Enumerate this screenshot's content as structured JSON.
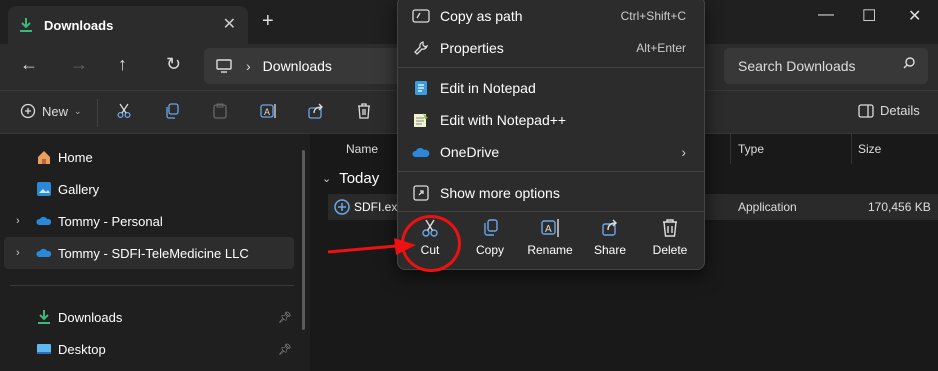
{
  "tab": {
    "title": "Downloads",
    "close": "✕",
    "new_tab": "+"
  },
  "window": {
    "minimize": "—",
    "maximize": "☐",
    "close": "✕"
  },
  "address": {
    "path": "Downloads",
    "separator": "›"
  },
  "search": {
    "placeholder": "Search Downloads"
  },
  "toolbar": {
    "new_label": "New",
    "details_label": "Details"
  },
  "sidebar": {
    "items": [
      {
        "label": "Home"
      },
      {
        "label": "Gallery"
      },
      {
        "label": "Tommy - Personal"
      },
      {
        "label": "Tommy - SDFI-TeleMedicine LLC"
      }
    ],
    "quick_access": [
      {
        "label": "Downloads"
      },
      {
        "label": "Desktop"
      }
    ]
  },
  "content": {
    "columns": [
      "Name",
      "Type",
      "Size"
    ],
    "group": "Today",
    "file": {
      "name": "SDFI.exe",
      "type": "Application",
      "size": "170,456 KB"
    }
  },
  "context_menu": {
    "items": [
      {
        "label": "Copy as path",
        "shortcut": "Ctrl+Shift+C"
      },
      {
        "label": "Properties",
        "shortcut": "Alt+Enter"
      },
      {
        "label": "Edit in Notepad"
      },
      {
        "label": "Edit with Notepad++"
      },
      {
        "label": "OneDrive"
      },
      {
        "label": "Show more options"
      }
    ],
    "actions": [
      "Cut",
      "Copy",
      "Rename",
      "Share",
      "Delete"
    ]
  },
  "colors": {
    "accent": "#0e7ad9",
    "onedrive": "#2b88d8",
    "annotation": "#e11111",
    "downloads_green": "#3cb878"
  }
}
